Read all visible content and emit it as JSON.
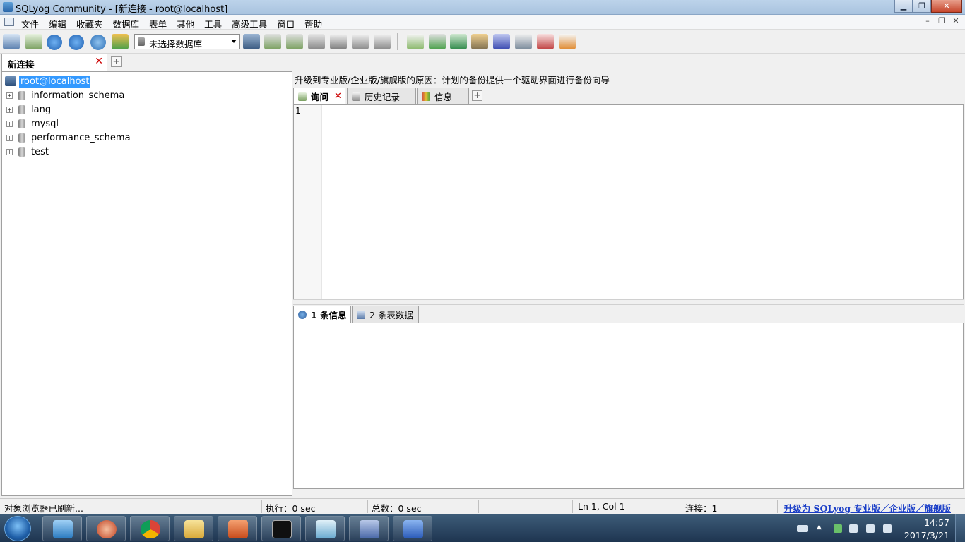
{
  "window": {
    "title": "SQLyog Community - [新连接 - root@localhost]"
  },
  "menu": {
    "items": [
      "文件",
      "编辑",
      "收藏夹",
      "数据库",
      "表单",
      "其他",
      "工具",
      "高级工具",
      "窗口",
      "帮助"
    ]
  },
  "toolbar": {
    "database_select": "未选择数据库"
  },
  "connection_tab": {
    "label": "新连接"
  },
  "object_browser": {
    "root": "root@localhost",
    "databases": [
      "information_schema",
      "lang",
      "mysql",
      "performance_schema",
      "test"
    ]
  },
  "upgrade_banner": "升级到专业版/企业版/旗舰版的原因：计划的备份提供一个驱动界面进行备份向导",
  "query_tabs": [
    "询问",
    "历史记录",
    "信息"
  ],
  "editor": {
    "line_numbers": [
      "1"
    ]
  },
  "result_tabs": [
    "1 条信息",
    "2 条表数据"
  ],
  "status": {
    "message": "对象浏览器已刷新...",
    "exec": "执行：0 sec",
    "total": "总数：0 sec",
    "position": "Ln 1, Col 1",
    "connections": "连接：1",
    "upgrade": "升级为 SQLyog 专业版／企业版／旗舰版"
  },
  "taskbar": {
    "time": "14:57",
    "date": "2017/3/21",
    "apps": [
      "file-manager",
      "snail-app",
      "chrome",
      "explorer-folder",
      "powerpoint",
      "cmd",
      "notepad",
      "sqlyog",
      "word"
    ]
  }
}
